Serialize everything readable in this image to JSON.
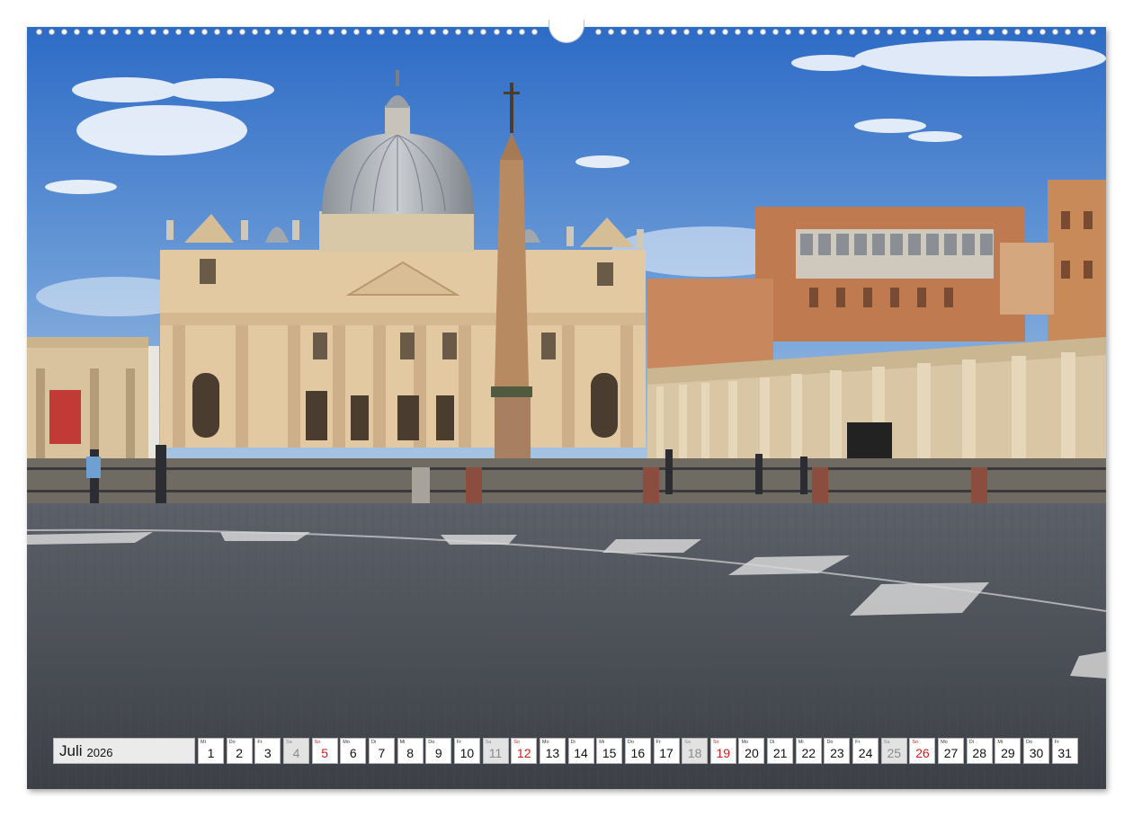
{
  "calendar": {
    "month": "Juli",
    "year": "2026",
    "days": [
      {
        "dow": "Mi",
        "num": "1",
        "type": "weekday"
      },
      {
        "dow": "Do",
        "num": "2",
        "type": "weekday"
      },
      {
        "dow": "Fr",
        "num": "3",
        "type": "weekday"
      },
      {
        "dow": "Sa",
        "num": "4",
        "type": "sat"
      },
      {
        "dow": "So",
        "num": "5",
        "type": "sun"
      },
      {
        "dow": "Mo",
        "num": "6",
        "type": "weekday"
      },
      {
        "dow": "Di",
        "num": "7",
        "type": "weekday"
      },
      {
        "dow": "Mi",
        "num": "8",
        "type": "weekday"
      },
      {
        "dow": "Do",
        "num": "9",
        "type": "weekday"
      },
      {
        "dow": "Fr",
        "num": "10",
        "type": "weekday"
      },
      {
        "dow": "Sa",
        "num": "11",
        "type": "sat"
      },
      {
        "dow": "So",
        "num": "12",
        "type": "sun"
      },
      {
        "dow": "Mo",
        "num": "13",
        "type": "weekday"
      },
      {
        "dow": "Di",
        "num": "14",
        "type": "weekday"
      },
      {
        "dow": "Mi",
        "num": "15",
        "type": "weekday"
      },
      {
        "dow": "Do",
        "num": "16",
        "type": "weekday"
      },
      {
        "dow": "Fr",
        "num": "17",
        "type": "weekday"
      },
      {
        "dow": "Sa",
        "num": "18",
        "type": "sat"
      },
      {
        "dow": "So",
        "num": "19",
        "type": "sun"
      },
      {
        "dow": "Mo",
        "num": "20",
        "type": "weekday"
      },
      {
        "dow": "Di",
        "num": "21",
        "type": "weekday"
      },
      {
        "dow": "Mi",
        "num": "22",
        "type": "weekday"
      },
      {
        "dow": "Do",
        "num": "23",
        "type": "weekday"
      },
      {
        "dow": "Fr",
        "num": "24",
        "type": "weekday"
      },
      {
        "dow": "Sa",
        "num": "25",
        "type": "sat"
      },
      {
        "dow": "So",
        "num": "26",
        "type": "sun"
      },
      {
        "dow": "Mo",
        "num": "27",
        "type": "weekday"
      },
      {
        "dow": "Di",
        "num": "28",
        "type": "weekday"
      },
      {
        "dow": "Mi",
        "num": "29",
        "type": "weekday"
      },
      {
        "dow": "Do",
        "num": "30",
        "type": "weekday"
      },
      {
        "dow": "Fr",
        "num": "31",
        "type": "weekday"
      }
    ]
  },
  "colors": {
    "sunday": "#d11b1b",
    "saturday_bg": "#e2e2e2",
    "sky_top": "#2f6fc8",
    "stone": "#e2c9a2"
  },
  "binding": {
    "hole_icon": "spiral-binding-hole-icon"
  }
}
